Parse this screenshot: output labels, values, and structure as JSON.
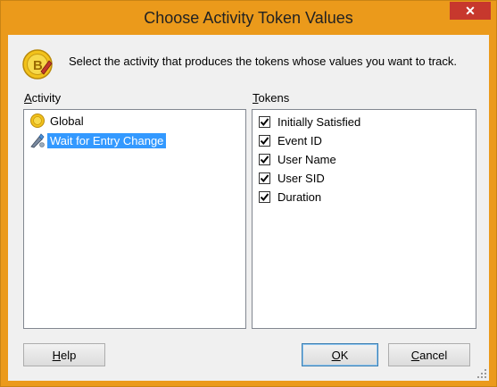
{
  "window": {
    "title": "Choose Activity Token Values"
  },
  "header": {
    "instruction": "Select the activity that produces the tokens whose values you want to track."
  },
  "activity": {
    "label_prefix": "A",
    "label_rest": "ctivity",
    "items": [
      {
        "label": "Global",
        "icon": "coin-icon",
        "selected": false
      },
      {
        "label": "Wait for Entry Change",
        "icon": "pen-activity-icon",
        "selected": true
      }
    ]
  },
  "tokens": {
    "label_prefix": "T",
    "label_rest": "okens",
    "items": [
      {
        "label": "Initially Satisfied",
        "checked": true
      },
      {
        "label": "Event ID",
        "checked": true
      },
      {
        "label": "User Name",
        "checked": true
      },
      {
        "label": "User SID",
        "checked": true
      },
      {
        "label": "Duration",
        "checked": true
      }
    ]
  },
  "buttons": {
    "help_prefix": "H",
    "help_rest": "elp",
    "ok_prefix": "O",
    "ok_rest": "K",
    "cancel_prefix": "C",
    "cancel_rest": "ancel"
  },
  "colors": {
    "titlebar": "#eb9a1b",
    "close": "#c7382d",
    "selection": "#3399ff"
  }
}
